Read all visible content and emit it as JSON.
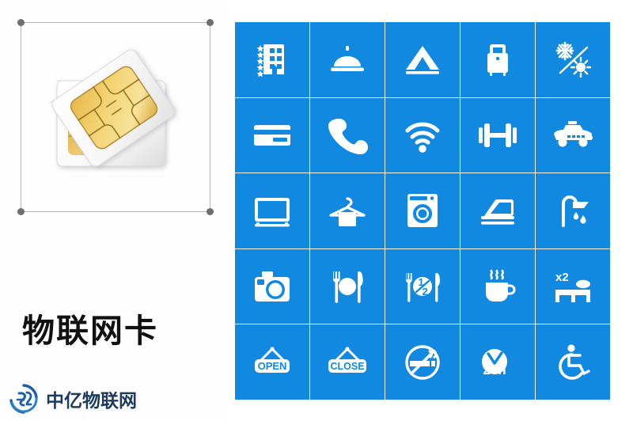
{
  "image": {
    "left_panel": {
      "product_title": "物联网卡",
      "artwork_name": "sim-card-pair",
      "selection": {
        "handle_count": 4,
        "border_color": "#b6b6b6",
        "handle_color": "#6f6f6f"
      },
      "watermark": {
        "logo_name": "zhongyi-circle-logo",
        "text": "中亿物联网",
        "color": "#1b3a5e",
        "logo_color": "#1d5fa8"
      }
    },
    "icon_grid": {
      "columns": 5,
      "rows": 5,
      "tile_color": "#1289e0",
      "glyph_color": "#ffffff",
      "gap_color": "#ffffff",
      "icons": [
        {
          "name": "hotel-stars-icon",
          "label": "5-star hotel"
        },
        {
          "name": "room-service-bell-icon",
          "label": "Room service"
        },
        {
          "name": "tent-camping-icon",
          "label": "Camping / tent"
        },
        {
          "name": "luggage-icon",
          "label": "Luggage storage"
        },
        {
          "name": "air-conditioning-icon",
          "label": "Air conditioning"
        },
        {
          "name": "credit-card-icon",
          "label": "Card payment"
        },
        {
          "name": "telephone-icon",
          "label": "Telephone"
        },
        {
          "name": "wifi-icon",
          "label": "Wi-Fi"
        },
        {
          "name": "dumbbell-gym-icon",
          "label": "Gym / fitness"
        },
        {
          "name": "taxi-icon",
          "label": "Taxi"
        },
        {
          "name": "television-icon",
          "label": "Television"
        },
        {
          "name": "hanger-towel-icon",
          "label": "Laundry / hanger"
        },
        {
          "name": "washing-machine-icon",
          "label": "Washing machine"
        },
        {
          "name": "iron-icon",
          "label": "Iron / ironing"
        },
        {
          "name": "shower-icon",
          "label": "Shower"
        },
        {
          "name": "camera-icon",
          "label": "Camera"
        },
        {
          "name": "restaurant-icon",
          "label": "Restaurant"
        },
        {
          "name": "half-board-icon",
          "label": "Half board",
          "text": "1/2"
        },
        {
          "name": "coffee-cup-icon",
          "label": "Coffee / hot drinks"
        },
        {
          "name": "twin-beds-icon",
          "label": "Twin beds",
          "text": "x2"
        },
        {
          "name": "open-sign-icon",
          "label": "Open sign",
          "text": "OPEN"
        },
        {
          "name": "close-sign-icon",
          "label": "Close sign",
          "text": "CLOSE"
        },
        {
          "name": "no-smoking-icon",
          "label": "No smoking"
        },
        {
          "name": "clock-24h-icon",
          "label": "24 hour service",
          "text": "24h"
        },
        {
          "name": "wheelchair-access-icon",
          "label": "Wheelchair accessible"
        }
      ]
    }
  }
}
